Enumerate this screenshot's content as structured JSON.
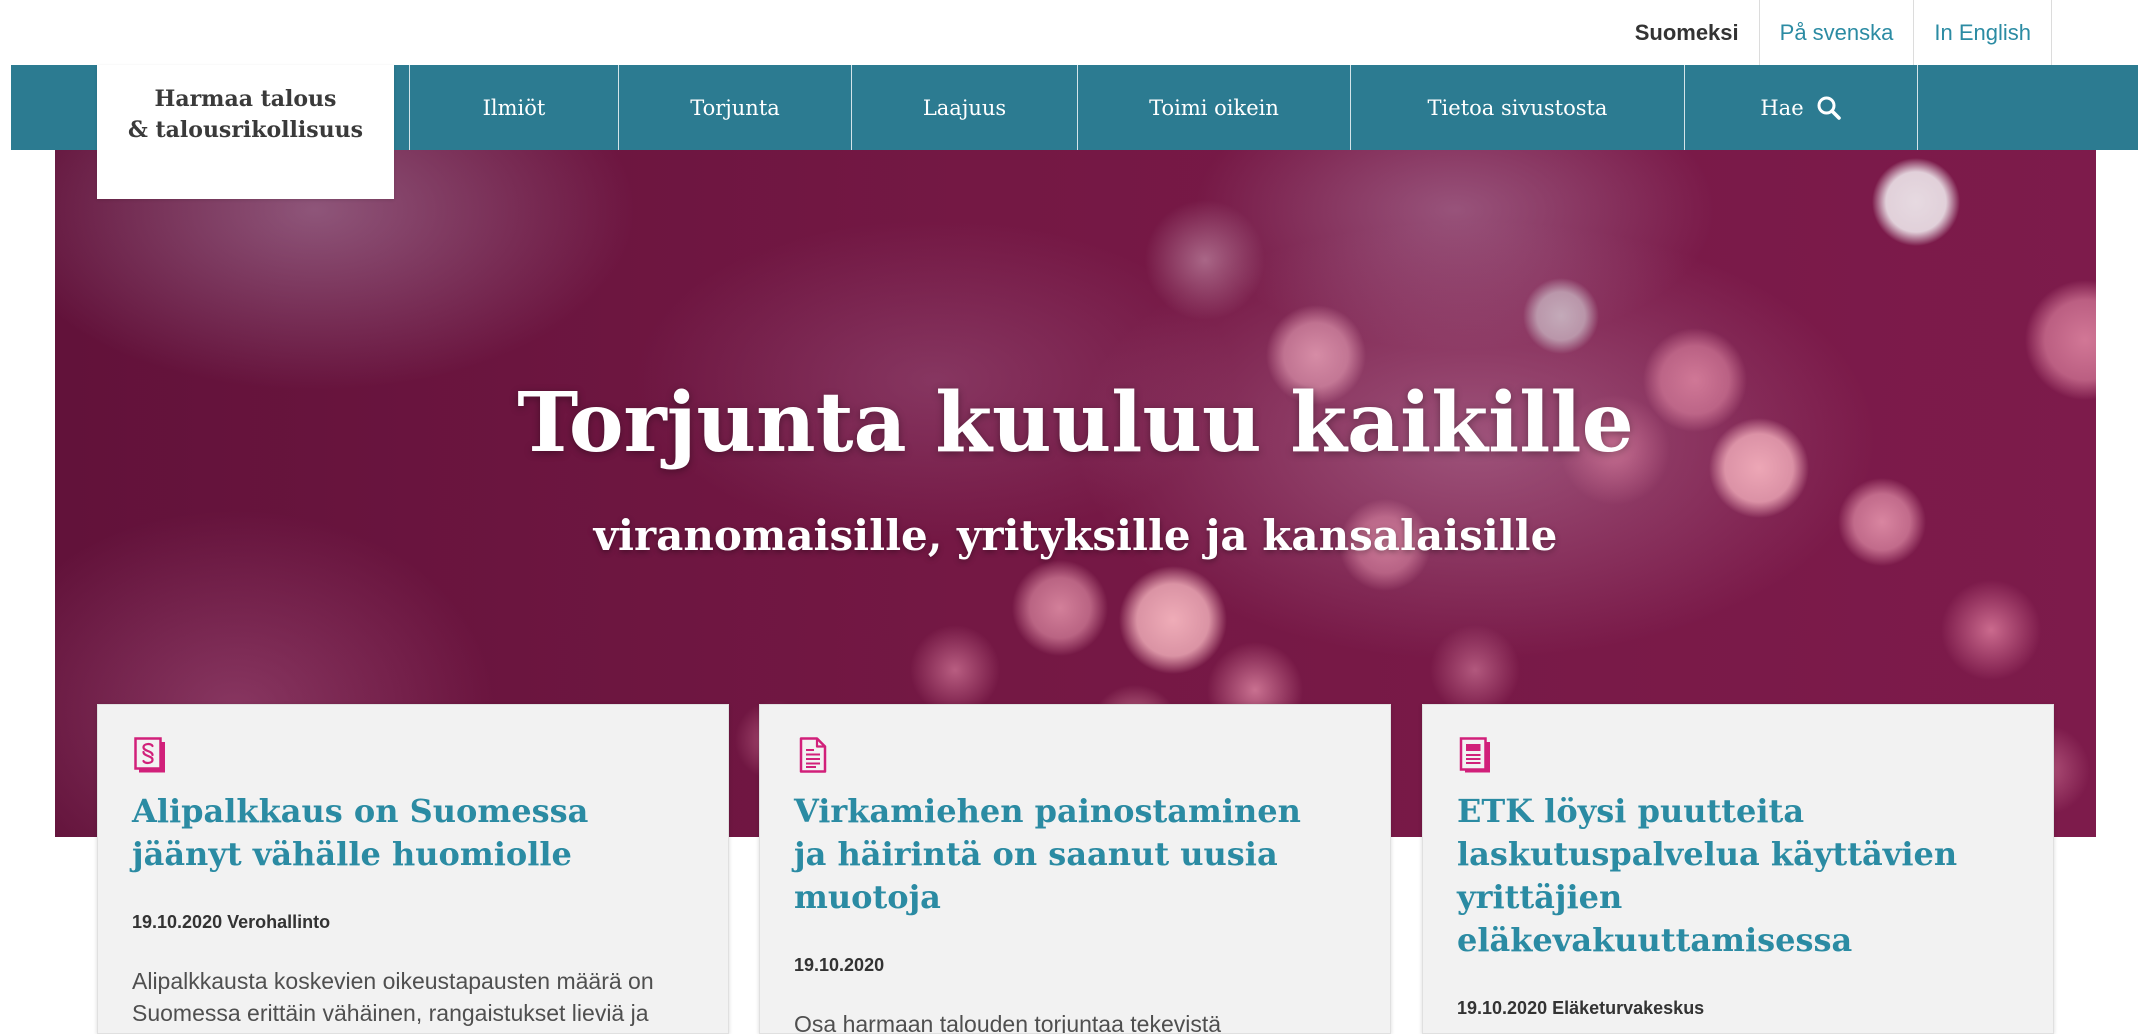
{
  "language_bar": {
    "items": [
      {
        "label": "Suomeksi",
        "active": true
      },
      {
        "label": "På svenska",
        "active": false
      },
      {
        "label": "In English",
        "active": false
      }
    ]
  },
  "header": {
    "logo": {
      "line1": "Harmaa talous",
      "line2": "& talousrikollisuus"
    },
    "nav": [
      {
        "label": "Ilmiöt"
      },
      {
        "label": "Torjunta"
      },
      {
        "label": "Laajuus"
      },
      {
        "label": "Toimi oikein"
      },
      {
        "label": "Tietoa sivustosta"
      },
      {
        "label": "Hae",
        "icon": "search-icon"
      }
    ]
  },
  "hero": {
    "title": "Torjunta kuuluu kaikille",
    "subtitle": "viranomaisille, yrityksille ja kansalaisille"
  },
  "news": [
    {
      "icon": "paragraph-icon",
      "title_lines": [
        "Alipalkkaus on Suomessa",
        "jäänyt vähälle huomiolle"
      ],
      "date": "19.10.2020",
      "source": "Verohallinto",
      "excerpt": "Alipalkkausta koskevien oikeustapausten määrä on Suomessa erittäin vähäinen, rangaistukset lieviä ja"
    },
    {
      "icon": "document-icon",
      "title_lines": [
        "Virkamiehen painostaminen",
        "ja häirintä on saanut uusia",
        "muotoja"
      ],
      "date": "19.10.2020",
      "excerpt": "Osa harmaan talouden torjuntaa tekevistä"
    },
    {
      "icon": "newspaper-icon",
      "title_lines": [
        "ETK löysi puutteita",
        "laskutuspalvelua käyttävien",
        "yrittäjien",
        "eläkevakuuttamisessa"
      ],
      "date": "19.10.2020",
      "source": "Eläketurvakeskus"
    }
  ],
  "colors": {
    "nav_background": "#2c7b91",
    "link_teal": "#2b8ba3",
    "icon_magenta": "#d1207a",
    "hero_background": "#741844",
    "card_background": "#f2f2f2"
  }
}
